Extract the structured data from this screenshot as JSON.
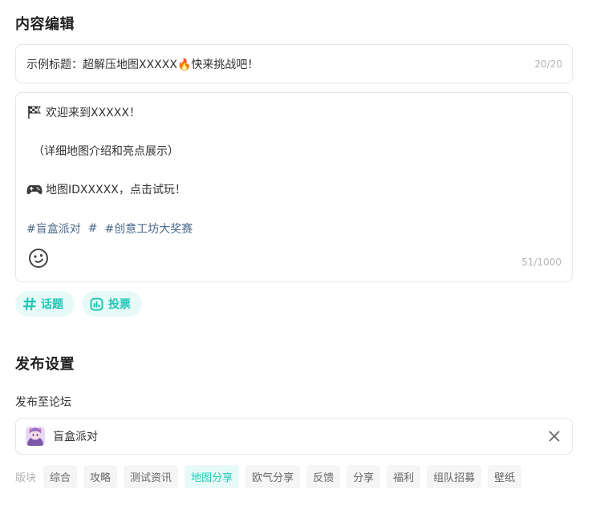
{
  "content": {
    "section_title": "内容编辑",
    "title_field": {
      "value": "示例标题：超解压地图XXXXX🔥快来挑战吧！",
      "counter": "20/20"
    },
    "body_field": {
      "line_welcome": "欢迎来到XXXXX！",
      "line_detail": "（详细地图介绍和亮点展示）",
      "line_map": "地图IDXXXXX，点击试玩！",
      "tag1": "#盲盒派对",
      "tag_sep": "#",
      "tag2": "#创意工坊大奖赛",
      "counter": "51/1000",
      "icons": [
        "flag-icon",
        "gamepad-icon",
        "emoji-icon"
      ]
    },
    "chips": [
      {
        "label": "话题",
        "icon": "hash-icon"
      },
      {
        "label": "投票",
        "icon": "poll-icon"
      }
    ]
  },
  "publish": {
    "section_title": "发布设置",
    "forum_label": "发布至论坛",
    "forum": {
      "name": "盲盒派对",
      "icon": "forum-avatar"
    },
    "board_label": "版块",
    "boards": [
      "综合",
      "攻略",
      "测试资讯",
      "地图分享",
      "欧气分享",
      "反馈",
      "分享",
      "福利",
      "组队招募",
      "壁纸"
    ],
    "active_board": "地图分享"
  },
  "colors": {
    "accent": "#1fc7b6",
    "chip_bg": "#e8faf8",
    "tag_text": "#4a6a8a",
    "border": "#e6e6e6"
  }
}
